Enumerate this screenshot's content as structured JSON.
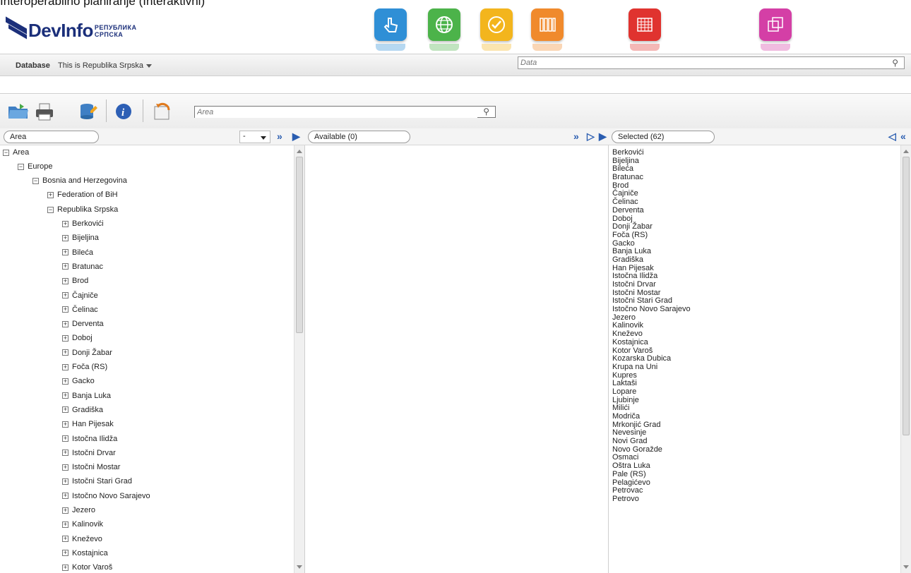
{
  "header": {
    "clipped_caption": "Interoperabilno planiranje (Interaktivni)",
    "logo_text": "DevInfo",
    "logo_sub_1": "РЕПУБЛИКА",
    "logo_sub_2": "СРПСКА",
    "app_icons": [
      {
        "name": "touch-icon",
        "color": "#2f8fd6",
        "glyph": "☝"
      },
      {
        "name": "globe-icon",
        "color": "#4cb34a",
        "glyph": "🌐"
      },
      {
        "name": "checkmark-icon",
        "color": "#f3b51d",
        "glyph": "✓"
      },
      {
        "name": "library-icon",
        "color": "#f08a2c",
        "glyph": "▥"
      },
      {
        "name": "table-grid-icon",
        "color": "#e0332f",
        "glyph": "▦"
      },
      {
        "name": "gallery-icon",
        "color": "#d43fa6",
        "glyph": "⧉"
      }
    ]
  },
  "db_bar": {
    "label": "Database",
    "name": "This is Republika Srpska"
  },
  "search": {
    "data_placeholder": "Data",
    "area_placeholder": "Area"
  },
  "panels": {
    "area_label": "Area",
    "level_value": "-",
    "available_label": "Available (0)",
    "selected_label": "Selected (62)"
  },
  "tree": {
    "root": "Area",
    "europe": "Europe",
    "bih": "Bosnia and Herzegovina",
    "fbih": "Federation of BiH",
    "rs": "Republika Srpska",
    "municipalities": [
      "Berkovići",
      "Bijeljina",
      "Bileća",
      "Bratunac",
      "Brod",
      "Čajniče",
      "Čelinac",
      "Derventa",
      "Doboj",
      "Donji Žabar",
      "Foča (RS)",
      "Gacko",
      "Banja Luka",
      "Gradiška",
      "Han Pijesak",
      "Istočna Ilidža",
      "Istočni Drvar",
      "Istočni Mostar",
      "Istočni Stari Grad",
      "Istočno Novo Sarajevo",
      "Jezero",
      "Kalinovik",
      "Kneževo",
      "Kostajnica",
      "Kotor Varoš"
    ]
  },
  "selected": [
    "Berkovići",
    "Bijeljina",
    "Bileća",
    "Bratunac",
    "Brod",
    "Čajniče",
    "Čelinac",
    "Derventa",
    "Doboj",
    "Donji Žabar",
    "Foča (RS)",
    "Gacko",
    "Banja Luka",
    "Gradiška",
    "Han Pijesak",
    "Istočna Ilidža",
    "Istočni Drvar",
    "Istočni Mostar",
    "Istočni Stari Grad",
    "Istočno Novo Sarajevo",
    "Jezero",
    "Kalinovik",
    "Kneževo",
    "Kostajnica",
    "Kotor Varoš",
    "Kozarska Dubica",
    "Krupa na Uni",
    "Kupres",
    "Laktaši",
    "Lopare",
    "Ljubinje",
    "Milići",
    "Modriča",
    "Mrkonjić Grad",
    "Nevesinje",
    "Novi Grad",
    "Novo Goražde",
    "Osmaci",
    "Oštra Luka",
    "Pale (RS)",
    "Pelagićevo",
    "Petrovac",
    "Petrovo"
  ]
}
